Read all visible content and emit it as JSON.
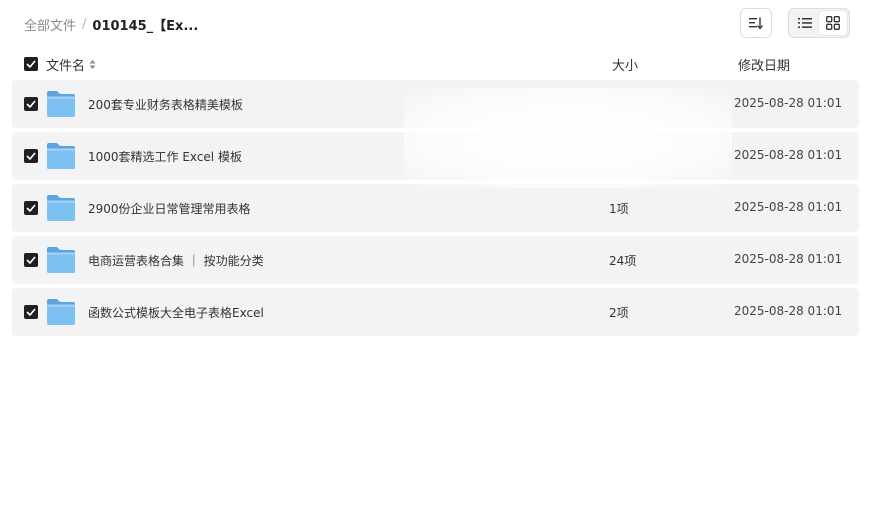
{
  "breadcrumb": {
    "root": "全部文件",
    "separator": "/",
    "current": "010145_【Ex..."
  },
  "toolbar": {
    "sort_icon": "sort-lines-icon",
    "list_view_icon": "list-view-icon",
    "grid_view_icon": "grid-view-icon",
    "active_view": "list"
  },
  "columns": {
    "name": "文件名",
    "size": "大小",
    "date": "修改日期"
  },
  "files": [
    {
      "name": "200套专业财务表格精美模板",
      "size": "",
      "date": "2025-08-28 01:01",
      "selected": true
    },
    {
      "name": "1000套精选工作 Excel 模板",
      "size": "",
      "date": "2025-08-28 01:01",
      "selected": true
    },
    {
      "name": "2900份企业日常管理常用表格",
      "size": "1项",
      "date": "2025-08-28 01:01",
      "selected": true
    },
    {
      "name": "电商运营表格合集 ｜ 按功能分类",
      "size": "24项",
      "date": "2025-08-28 01:01",
      "selected": true
    },
    {
      "name": "函数公式模板大全电子表格Excel",
      "size": "2项",
      "date": "2025-08-28 01:01",
      "selected": true
    }
  ],
  "colors": {
    "row_bg": "#f3f3f3",
    "checkbox": "#1f1f1f",
    "folder": "#6fb6ec"
  }
}
